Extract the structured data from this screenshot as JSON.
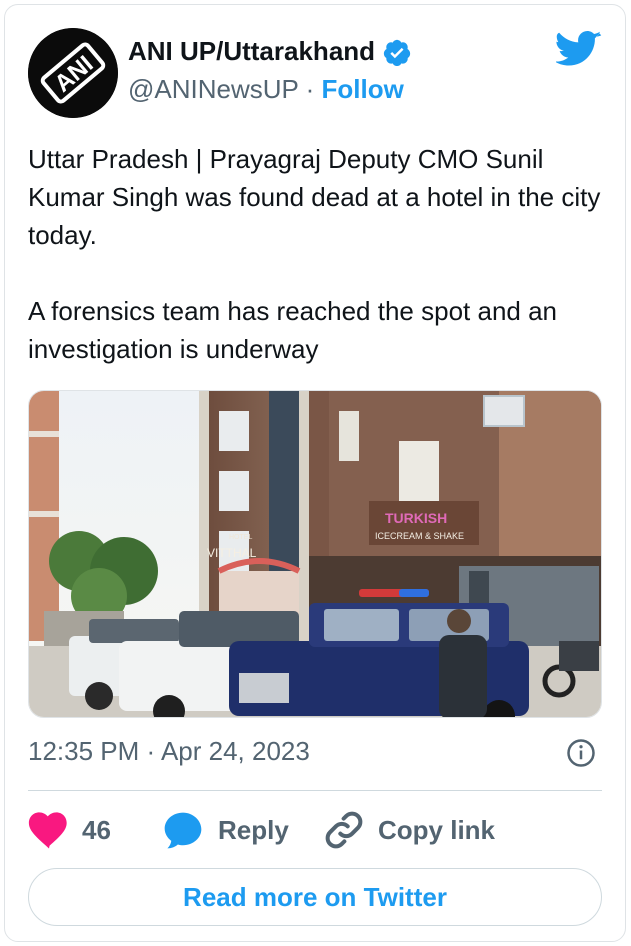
{
  "author": {
    "display_name": "ANI UP/Uttarakhand",
    "handle": "@ANINewsUP",
    "separator": "·",
    "follow_label": "Follow",
    "avatar_text": "ANI",
    "verified": true
  },
  "tweet": {
    "text_paragraphs": [
      "Uttar Pradesh | Prayagraj Deputy CMO Sunil Kumar Singh was found dead at a hotel in the city today.",
      "A forensics team has reached the spot and an investigation is underway"
    ],
    "timestamp": "12:35 PM · Apr 24, 2023"
  },
  "media": {
    "signs": {
      "hotel": "HOTEL",
      "hotel_name": "VITTHAL",
      "shop_brand": "TURKISH",
      "shop_sub": "ICECREAM & SHAKE"
    }
  },
  "actions": {
    "like_count": "46",
    "reply_label": "Reply",
    "copy_link_label": "Copy link"
  },
  "footer": {
    "read_more_label": "Read more on Twitter"
  },
  "colors": {
    "accent": "#1d9bf0",
    "like": "#f91880",
    "secondary_text": "#536471"
  },
  "icons": [
    "twitter-bird-icon",
    "verified-badge-icon",
    "info-icon",
    "heart-icon",
    "reply-bubble-icon",
    "link-icon"
  ]
}
